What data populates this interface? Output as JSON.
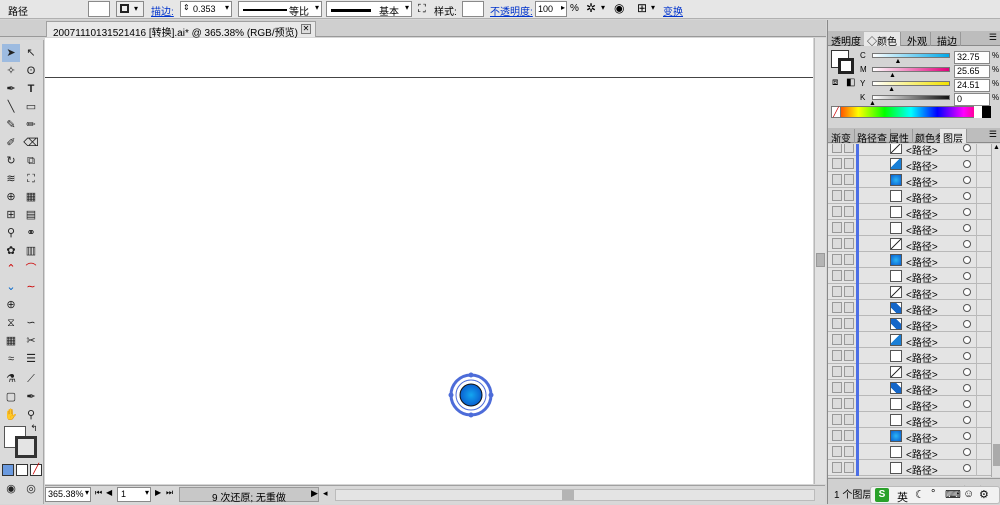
{
  "control_bar": {
    "object_label": "路径",
    "stroke_label": "描边:",
    "stroke_weight": "0.353",
    "stroke_profile": "等比",
    "brush": "基本",
    "style_label": "样式:",
    "opacity_label": "不透明度:",
    "opacity_value": "100",
    "opacity_unit": "%",
    "transform_label": "变换"
  },
  "document": {
    "tab_title": "20071110131521416 [转换].ai* @ 365.38% (RGB/预览)",
    "zoom": "365.38%",
    "artboard": "1",
    "status_text": "9 次还原; 无重做"
  },
  "color_panel": {
    "tabs": [
      "透明度",
      "颜色",
      "外观",
      "描边"
    ],
    "active_tab": "颜色",
    "channels": [
      {
        "name": "C",
        "value": "32.75",
        "pct": 32.75,
        "color": "#00a8e8"
      },
      {
        "name": "M",
        "value": "25.65",
        "pct": 25.65,
        "color": "#e0007a"
      },
      {
        "name": "Y",
        "value": "24.51",
        "pct": 24.51,
        "color": "#f2e200"
      },
      {
        "name": "K",
        "value": "0",
        "pct": 0,
        "color": "#111111"
      }
    ],
    "unit": "%"
  },
  "layers_panel": {
    "tabs": [
      "渐变",
      "路径查",
      "属性",
      "颜色参",
      "图层"
    ],
    "active_tab": "图层",
    "rows": [
      {
        "name": "<路径>",
        "thumb": "line"
      },
      {
        "name": "<路径>",
        "thumb": "blue-diag"
      },
      {
        "name": "<路径>",
        "thumb": "blue-grad"
      },
      {
        "name": "<路径>",
        "thumb": "empty"
      },
      {
        "name": "<路径>",
        "thumb": "empty"
      },
      {
        "name": "<路径>",
        "thumb": "empty"
      },
      {
        "name": "<路径>",
        "thumb": "line"
      },
      {
        "name": "<路径>",
        "thumb": "blue-grad"
      },
      {
        "name": "<路径>",
        "thumb": "empty"
      },
      {
        "name": "<路径>",
        "thumb": "line"
      },
      {
        "name": "<路径>",
        "thumb": "blue-shape"
      },
      {
        "name": "<路径>",
        "thumb": "blue-shape"
      },
      {
        "name": "<路径>",
        "thumb": "blue-diag"
      },
      {
        "name": "<路径>",
        "thumb": "empty"
      },
      {
        "name": "<路径>",
        "thumb": "line"
      },
      {
        "name": "<路径>",
        "thumb": "blue-shape"
      },
      {
        "name": "<路径>",
        "thumb": "empty"
      },
      {
        "name": "<路径>",
        "thumb": "empty"
      },
      {
        "name": "<路径>",
        "thumb": "blue-grad"
      },
      {
        "name": "<路径>",
        "thumb": "empty"
      },
      {
        "name": "<路径>",
        "thumb": "empty"
      }
    ],
    "footer": "1 个图层"
  },
  "taskbar": {
    "ime_label": "英"
  },
  "colors": {
    "accent_blue": "#1a8fe0",
    "link_blue": "#0033cc",
    "layer_color": "#4c6fe6"
  }
}
